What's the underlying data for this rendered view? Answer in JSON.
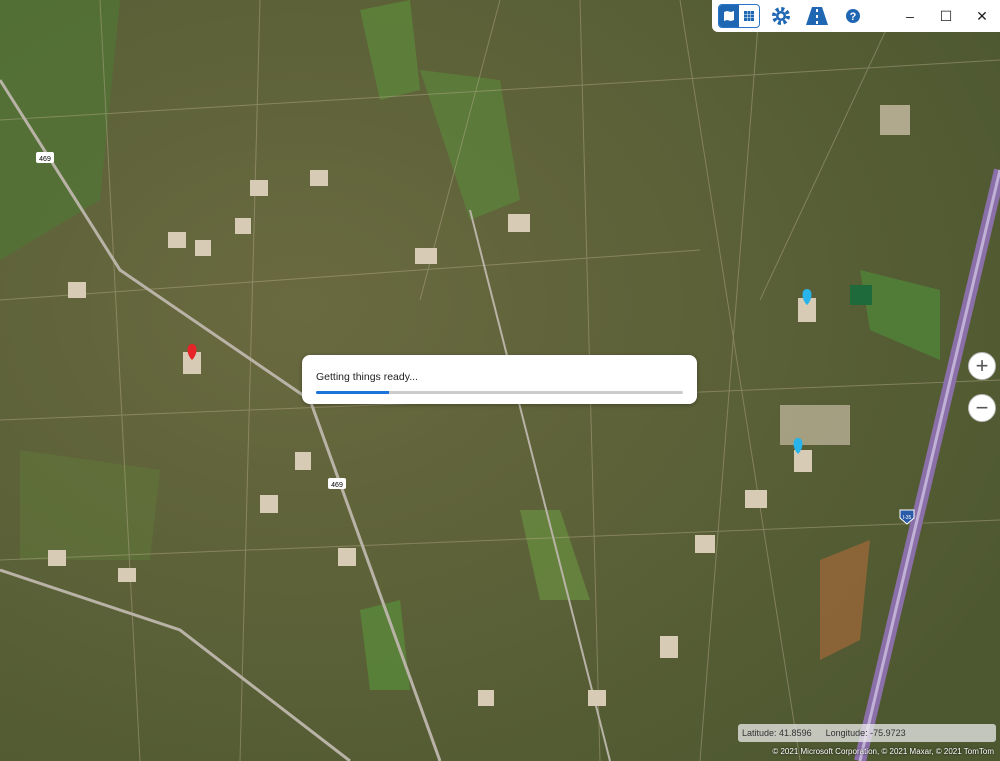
{
  "toolbar": {
    "map_view_icon": "map-icon",
    "grid_view_icon": "grid-icon",
    "settings_icon": "gear-icon",
    "road_icon": "road-icon",
    "help_icon": "question-icon",
    "minimize": "–",
    "maximize": "☐",
    "close": "✕"
  },
  "map": {
    "road_labels": [
      "469",
      "469",
      "I-35"
    ],
    "pins": [
      {
        "color": "#e8242b"
      },
      {
        "color": "#28b4ea"
      },
      {
        "color": "#28b4ea"
      }
    ]
  },
  "zoom": {
    "in": "+",
    "out": "−"
  },
  "loading": {
    "message": "Getting things ready...",
    "progress": 0.2
  },
  "coords": {
    "latitude_label": "Latitude:",
    "latitude": "41.8596",
    "longitude_label": "Longitude:",
    "longitude": "-75.9723"
  },
  "copyright": "© 2021 Microsoft Corporation, © 2021 Maxar, © 2021 TomTom",
  "colors": {
    "accent": "#1f66b3",
    "progress": "#1a73d9"
  }
}
